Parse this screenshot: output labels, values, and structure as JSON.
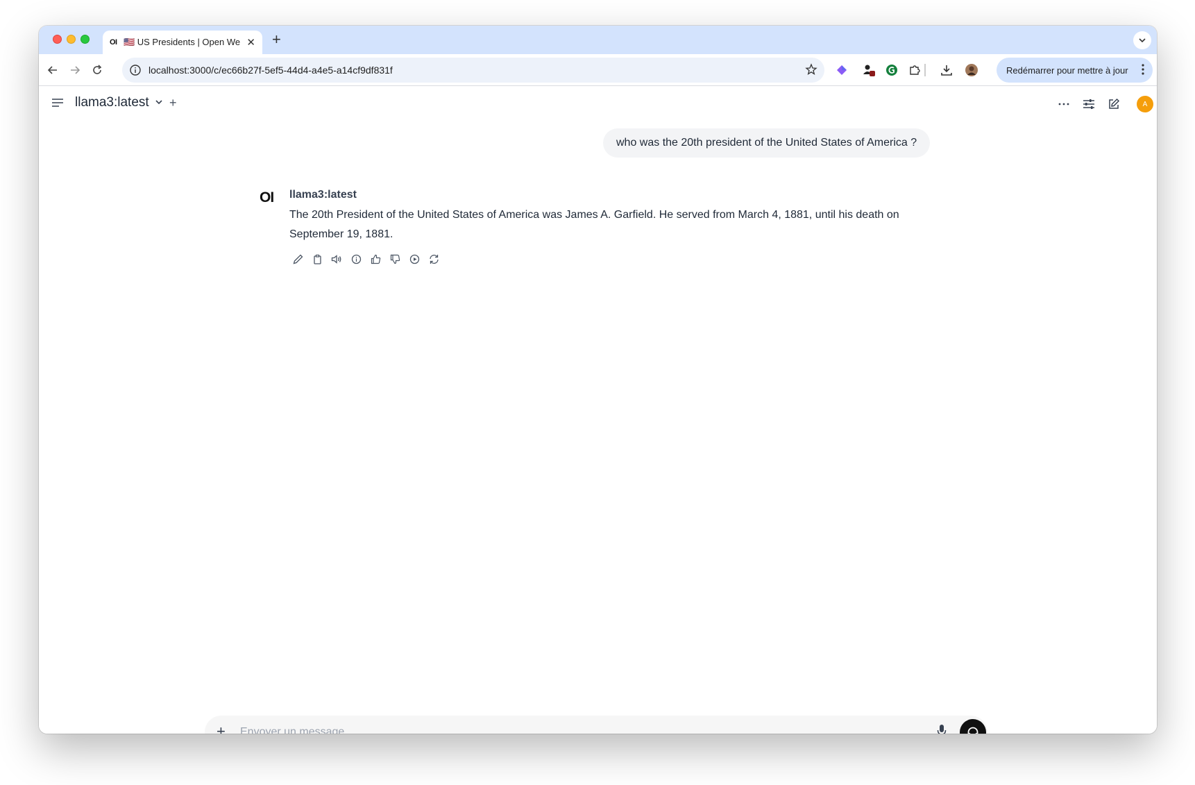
{
  "browser": {
    "tab": {
      "favicon_text": "OI",
      "title": "🇺🇸 US Presidents | Open WebUI"
    },
    "url": "localhost:3000/c/ec66b27f-5ef5-44d4-a4e5-a14cf9df831f",
    "update_button_label": "Redémarrer pour mettre à jour"
  },
  "app": {
    "model_name": "llama3:latest",
    "user_avatar_initial": "A",
    "accent_color": "#f59e0b"
  },
  "chat": {
    "user_message": "who was the 20th president of the United States of America ?",
    "assistant": {
      "logo_text": "OI",
      "name": "llama3:latest",
      "message": "The 20th President of the United States of America was James A. Garfield. He served from March 4, 1881, until his death on September 19, 1881."
    },
    "action_icons": [
      "edit-icon",
      "copy-icon",
      "speaker-icon",
      "info-icon",
      "thumbs-up-icon",
      "thumbs-down-icon",
      "play-icon",
      "regenerate-icon"
    ]
  },
  "composer": {
    "placeholder": "Envoyer un message"
  },
  "help_label": "?"
}
